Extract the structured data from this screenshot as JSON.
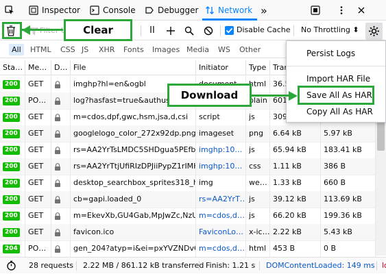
{
  "tabs": {
    "picker_label": "",
    "inspector": "Inspector",
    "console": "Console",
    "debugger": "Debugger",
    "network": "Network",
    "more": "»"
  },
  "toolbar": {
    "filter_placeholder": "Filter URLs",
    "pause_label": "II",
    "disable_cache_label": "Disable Cache",
    "disable_cache_checked": true,
    "throttling_label": "No Throttling ⬍"
  },
  "filters": [
    "All",
    "HTML",
    "CSS",
    "JS",
    "XHR",
    "Fonts",
    "Images",
    "Media",
    "WS",
    "Other"
  ],
  "columns": [
    "Sta…",
    "Me…",
    "D…",
    "File",
    "Initiator",
    "Type",
    "Tran"
  ],
  "rows": [
    {
      "status": "200",
      "method": "GET",
      "file": "imghp?hl=en&ogbl",
      "initiator": "document",
      "type": "html",
      "transferred": "36.5",
      "size": ""
    },
    {
      "status": "200",
      "method": "PO…",
      "file": "log?hasfast=true&authuse",
      "initiator": "",
      "type": "plain",
      "transferred": "601",
      "size": ""
    },
    {
      "status": "200",
      "method": "GET",
      "file": "m=cdos,dpf,gwc,hsm,jsa,d,csi",
      "initiator": "script",
      "type": "js",
      "transferred": "309",
      "size": ""
    },
    {
      "status": "200",
      "method": "GET",
      "file": "googlelogo_color_272x92dp.png",
      "initiator": "imageset",
      "type": "png",
      "transferred": "6.64 kB",
      "size": "5.97 kB"
    },
    {
      "status": "200",
      "method": "GET",
      "file": "rs=AA2YrTsLMDC5SHDgua5PEfbsQ",
      "initiator": "imghp:10…",
      "type": "js",
      "transferred": "65.94 kB",
      "size": "183.41 kB"
    },
    {
      "status": "200",
      "method": "GET",
      "file": "rs=AA2YrTtjUfiRIzDPJiiPypZ1rIMH6J",
      "initiator": "imghp:10…",
      "type": "css",
      "transferred": "1.11 kB",
      "size": "386 B"
    },
    {
      "status": "200",
      "method": "GET",
      "file": "desktop_searchbox_sprites318_hr.",
      "initiator": "img",
      "type": "we…",
      "transferred": "1.33 kB",
      "size": "660 B"
    },
    {
      "status": "200",
      "method": "GET",
      "file": "cb=gapi.loaded_0",
      "initiator": "rs=AA2YrT…",
      "type": "js",
      "transferred": "39.12 kB",
      "size": "113.69 kB"
    },
    {
      "status": "200",
      "method": "GET",
      "file": "m=EkevXb,GU4Gab,MpJwZc,NzU6V",
      "initiator": "m=cdos,d…",
      "type": "js",
      "transferred": "66.20 kB",
      "size": "199.36 kB"
    },
    {
      "status": "200",
      "method": "GET",
      "file": "favicon.ico",
      "initiator": "FaviconLo…",
      "type": "x-ic…",
      "transferred": "2.22 kB",
      "size": "5.43 kB"
    },
    {
      "status": "204",
      "method": "PO…",
      "file": "gen_204?atyp=i&ei=pxYVZNDvG6-",
      "initiator": "m=cdos,d…",
      "type": "html",
      "transferred": "453 B",
      "size": "0 B"
    }
  ],
  "status_bar": {
    "requests": "28 requests",
    "transferred": "2.22 MB / 861.12 kB transferred",
    "finish": "Finish: 1.21 s",
    "dom_content_loaded": "DOMContentLoaded: 149 ms",
    "load_prefix": "lo"
  },
  "menu": {
    "persist_logs": "Persist Logs",
    "import_har": "Import HAR File",
    "save_all_har": "Save All As HAR",
    "copy_all_har": "Copy All As HAR"
  },
  "annotations": {
    "clear": "Clear",
    "download": "Download"
  },
  "colors": {
    "accent": "#0a84ff",
    "status_ok": "#12bc00",
    "callout_green": "#2ca83a"
  }
}
